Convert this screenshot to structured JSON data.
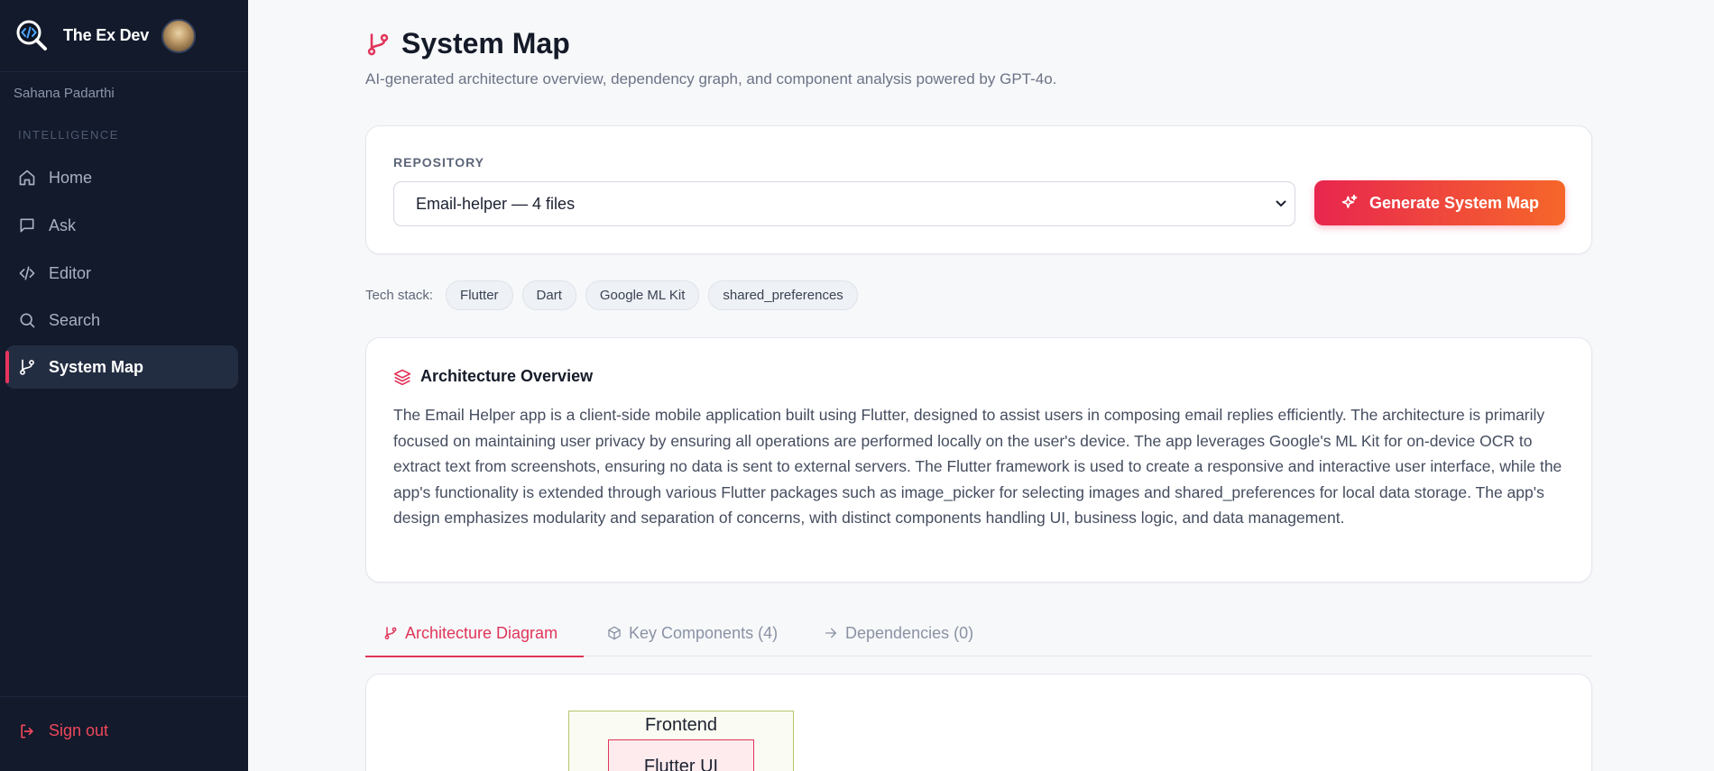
{
  "sidebar": {
    "brand": "The Ex Dev",
    "user_name": "Sahana Padarthi",
    "section_label": "INTELLIGENCE",
    "items": [
      {
        "label": "Home",
        "icon": "home-icon"
      },
      {
        "label": "Ask",
        "icon": "chat-icon"
      },
      {
        "label": "Editor",
        "icon": "code-icon"
      },
      {
        "label": "Search",
        "icon": "search-icon"
      },
      {
        "label": "System Map",
        "icon": "git-branch-icon",
        "active": true
      }
    ],
    "sign_out": "Sign out"
  },
  "header": {
    "title": "System Map",
    "subtitle": "AI-generated architecture overview, dependency graph, and component analysis powered by GPT-4o."
  },
  "repository": {
    "label": "REPOSITORY",
    "selected": "Email-helper — 4 files",
    "generate_label": "Generate System Map"
  },
  "tech_stack": {
    "label": "Tech stack:",
    "items": [
      "Flutter",
      "Dart",
      "Google ML Kit",
      "shared_preferences"
    ]
  },
  "architecture": {
    "title": "Architecture Overview",
    "text": "The Email Helper app is a client-side mobile application built using Flutter, designed to assist users in composing email replies efficiently. The architecture is primarily focused on maintaining user privacy by ensuring all operations are performed locally on the user's device. The app leverages Google's ML Kit for on-device OCR to extract text from screenshots, ensuring no data is sent to external servers. The Flutter framework is used to create a responsive and interactive user interface, while the app's functionality is extended through various Flutter packages such as image_picker for selecting images and shared_preferences for local data storage. The app's design emphasizes modularity and separation of concerns, with distinct components handling UI, business logic, and data management."
  },
  "tabs": [
    {
      "label": "Architecture Diagram",
      "active": true
    },
    {
      "label": "Key Components (4)"
    },
    {
      "label": "Dependencies (0)"
    }
  ],
  "diagram": {
    "group_label": "Frontend",
    "node_label": "Flutter UI"
  },
  "colors": {
    "accent": "#e0355a",
    "gradient_end": "#f6672a",
    "sidebar_bg": "#121a2b"
  }
}
